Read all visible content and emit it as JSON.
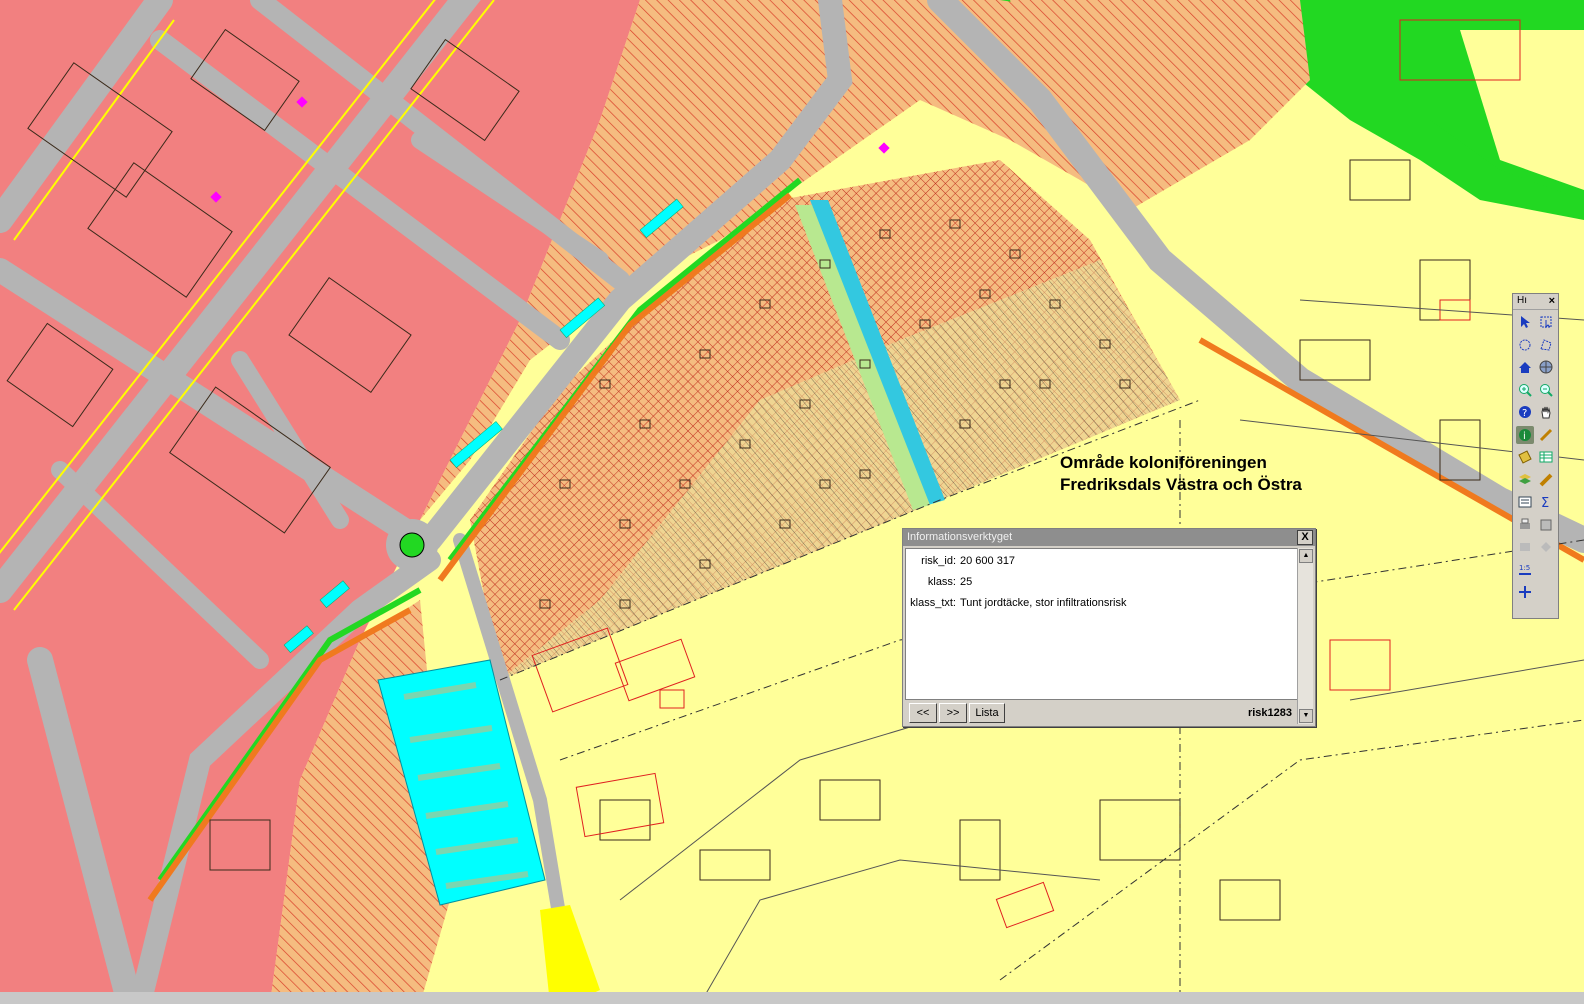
{
  "map": {
    "label_line1": "Område koloniföreningen",
    "label_line2": "Fredriksdals Västra och Östra",
    "colors": {
      "commercial": "#f28080",
      "residential": "#ffff99",
      "hatched": "#f5bc80",
      "green": "#22d822",
      "road": "#b4b4b4",
      "water": "#00ffff",
      "orange": "#f07a1e"
    }
  },
  "info_window": {
    "title": "Informationsverktyget",
    "close_label": "X",
    "fields": [
      {
        "key": "risk_id:",
        "value": "20 600 317"
      },
      {
        "key": "klass:",
        "value": "25"
      },
      {
        "key": "klass_txt:",
        "value": "Tunt jordtäcke, stor infiltrationsrisk"
      }
    ],
    "prev_label": "<<",
    "next_label": ">>",
    "list_label": "Lista",
    "layer_name": "risk1283"
  },
  "toolbar": {
    "title": "Hı",
    "close_label": "×",
    "icons": [
      "select-arrow-icon",
      "select-rect-icon",
      "select-circle-icon",
      "select-polygon-icon",
      "home-icon",
      "globe-icon",
      "zoom-in-icon",
      "zoom-out-icon",
      "help-icon",
      "pan-hand-icon",
      "info-icon",
      "bookmark-icon",
      "tag-icon",
      "table-icon",
      "layers-icon",
      "ruler-icon",
      "list-icon",
      "sum-icon",
      "print-icon",
      "export-icon",
      "disabled-a-icon",
      "disabled-b-icon",
      "scale-icon",
      "crosshair-icon"
    ]
  }
}
